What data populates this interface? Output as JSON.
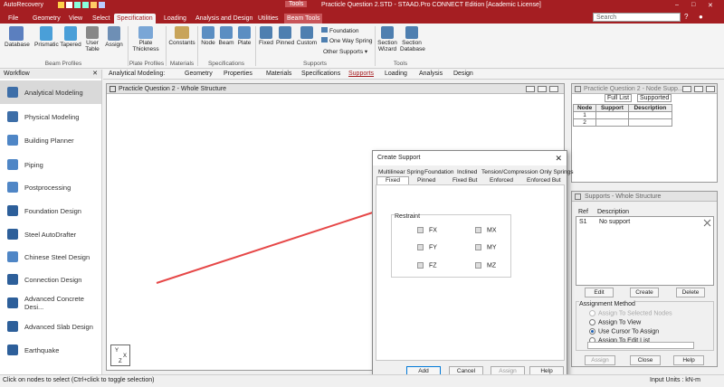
{
  "titlebar": {
    "autorecovery": "AutoRecovery",
    "contextual_group": "Tools",
    "window_title": "Practicle Question 2.STD - STAAD.Pro CONNECT Edition [Academic License]"
  },
  "ribbon_tabs": [
    "File",
    "Geometry",
    "View",
    "Select",
    "Specification",
    "Loading",
    "Analysis and Design",
    "Utilities",
    "Beam Tools"
  ],
  "search_placeholder": "Search",
  "ribbon": {
    "beam_profiles": {
      "database": "Database",
      "prismatic": "Prismatic",
      "tapered": "Tapered",
      "user_table": "User Table",
      "assign": "Assign",
      "label": "Beam Profiles"
    },
    "plate_profiles": {
      "plate_thickness": "Plate Thickness",
      "label": "Plate Profiles"
    },
    "materials": {
      "constants": "Constants",
      "label": "Materials"
    },
    "specifications": {
      "node": "Node",
      "beam": "Beam",
      "plate": "Plate",
      "label": "Specifications"
    },
    "supports": {
      "fixed": "Fixed",
      "pinned": "Pinned",
      "custom": "Custom",
      "foundation": "Foundation",
      "one_way_spring": "One Way Spring",
      "other_supports": "Other Supports",
      "label": "Supports"
    },
    "tools": {
      "section_wizard": "Section Wizard",
      "section_database": "Section Database",
      "label": "Tools"
    }
  },
  "workflow": {
    "header": "Workflow",
    "items": [
      "Analytical Modeling",
      "Physical Modeling",
      "Building Planner",
      "Piping",
      "Postprocessing",
      "Foundation Design",
      "Steel AutoDrafter",
      "Chinese Steel Design",
      "Connection Design",
      "Advanced Concrete Desi...",
      "Advanced Slab Design",
      "Earthquake"
    ]
  },
  "pagebar": {
    "prefix": "Analytical Modeling:",
    "items": [
      "Geometry",
      "Properties",
      "Materials",
      "Specifications",
      "Supports",
      "Loading",
      "Analysis",
      "Design"
    ]
  },
  "main_window": {
    "title": "Practicle Question 2 - Whole Structure"
  },
  "node_window": {
    "title": "Practicle Question 2 - Node Supp...",
    "tabs": [
      "Full List",
      "Supported"
    ],
    "headers": [
      "Node",
      "Support",
      "Description"
    ],
    "rows": [
      [
        "1",
        "",
        ""
      ],
      [
        "2",
        "",
        ""
      ]
    ]
  },
  "dialog": {
    "title": "Create Support",
    "tabs_row1": [
      "Multilinear Spring",
      "Foundation",
      "Inclined",
      "Tension/Compression Only Springs"
    ],
    "tabs_row2": [
      "Fixed",
      "Pinned",
      "Fixed But",
      "Enforced",
      "Enforced But"
    ],
    "restraint_label": "Restraint",
    "restraints": [
      "FX",
      "FY",
      "FZ",
      "MX",
      "MY",
      "MZ"
    ],
    "buttons": [
      "Add",
      "Cancel",
      "Assign",
      "Help"
    ]
  },
  "supports_window": {
    "title": "Supports - Whole Structure",
    "headers": [
      "Ref",
      "Description"
    ],
    "rows": [
      [
        "S1",
        "No support"
      ]
    ],
    "buttons": [
      "Edit",
      "Create",
      "Delete"
    ],
    "assignment_method": "Assignment Method",
    "options": [
      "Assign To Selected Nodes",
      "Assign To View",
      "Use Cursor To Assign",
      "Assign To Edit List"
    ],
    "bottom_buttons": [
      "Assign",
      "Close",
      "Help"
    ]
  },
  "statusbar": {
    "hint": "Click on nodes to select (Ctrl+click to toggle selection)",
    "units": "Input Units : kN-m"
  },
  "colors": {
    "brand": "#a51e22",
    "line": "#e64848"
  }
}
